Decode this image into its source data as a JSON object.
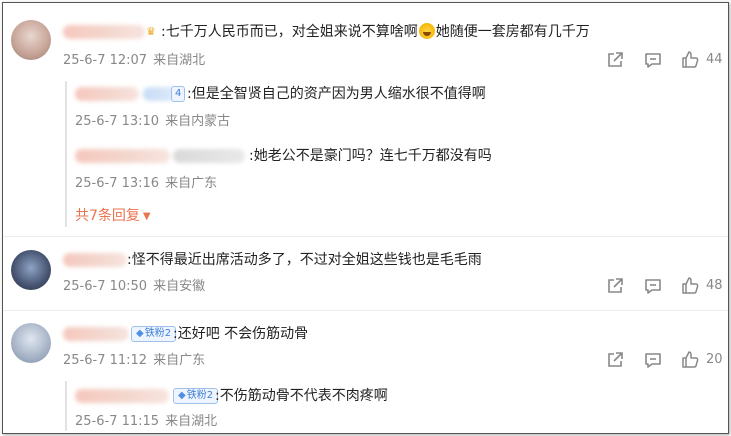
{
  "comments": [
    {
      "text": ":七千万人民币而已，对全姐来说不算啥啊",
      "text_after_emoji": "她随便一套房都有几千万",
      "date": "25-6-7 12:07",
      "location": "来自湖北",
      "likes": "44",
      "replies": [
        {
          "badge": "4",
          "text": ":但是全智贤自己的资产因为男人缩水很不值得啊",
          "date": "25-6-7 13:10",
          "location": "来自内蒙古"
        },
        {
          "text": ":她老公不是豪门吗？连七千万都没有吗",
          "date": "25-6-7 13:16",
          "location": "来自广东"
        }
      ],
      "more_replies": "共7条回复"
    },
    {
      "text": ":怪不得最近出席活动多了，不过对全姐这些钱也是毛毛雨",
      "date": "25-6-7 10:50",
      "location": "来自安徽",
      "likes": "48"
    },
    {
      "badge": "铁粉2",
      "text": ":还好吧 不会伤筋动骨",
      "date": "25-6-7 11:12",
      "location": "来自广东",
      "likes": "20",
      "replies": [
        {
          "badge": "铁粉2",
          "text": ":不伤筋动骨不代表不肉疼啊",
          "date": "25-6-7 11:15",
          "location": "来自湖北"
        }
      ]
    }
  ],
  "icons": {
    "share": "share-icon",
    "comment": "comment-icon",
    "like": "thumbs-up-icon",
    "badge": "diamond-icon",
    "crown": "crown-icon",
    "emoji": "laughing-emoji-icon"
  },
  "colors": {
    "accent": "#eb7350",
    "meta": "#888888",
    "badge": "#3f7ed6"
  }
}
